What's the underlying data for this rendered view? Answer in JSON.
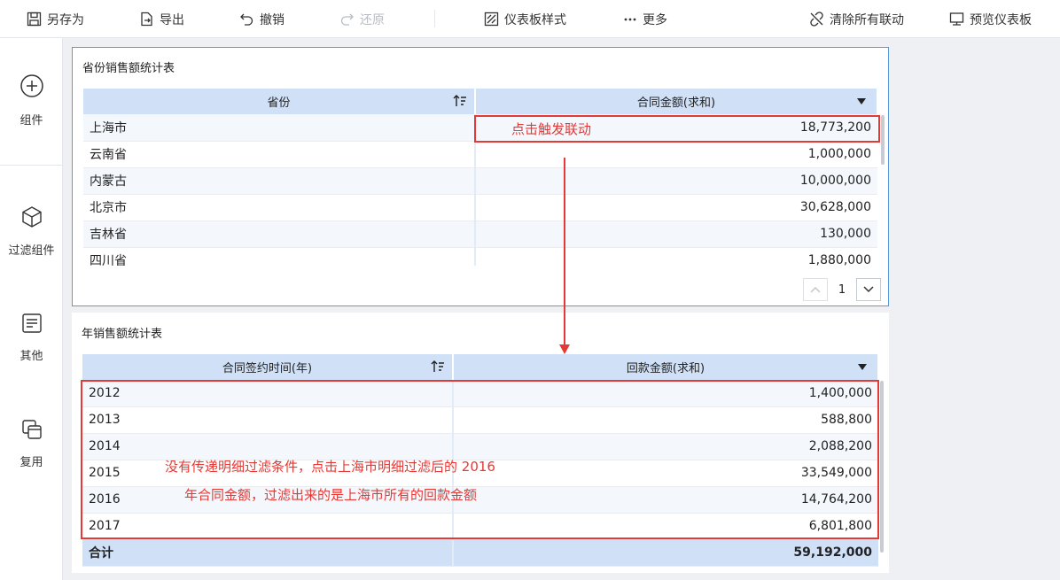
{
  "toolbar": {
    "save_as": "另存为",
    "export": "导出",
    "undo": "撤销",
    "redo": "还原",
    "dashboard_style": "仪表板样式",
    "more": "更多",
    "clear_links": "清除所有联动",
    "preview": "预览仪表板"
  },
  "rail": {
    "components": "组件",
    "filter_components": "过滤组件",
    "others": "其他",
    "reuse": "复用"
  },
  "table1": {
    "title": "省份销售额统计表",
    "col1": "省份",
    "col2": "合同金额(求和)",
    "rows": [
      {
        "province": "上海市",
        "amount": "18,773,200"
      },
      {
        "province": "云南省",
        "amount": "1,000,000"
      },
      {
        "province": "内蒙古",
        "amount": "10,000,000"
      },
      {
        "province": "北京市",
        "amount": "30,628,000"
      },
      {
        "province": "吉林省",
        "amount": "130,000"
      },
      {
        "province": "四川省",
        "amount": "1,880,000"
      }
    ],
    "page": "1"
  },
  "table2": {
    "title": "年销售额统计表",
    "col1": "合同签约时间(年)",
    "col2": "回款金额(求和)",
    "rows": [
      {
        "year": "2012",
        "amount": "1,400,000"
      },
      {
        "year": "2013",
        "amount": "588,800"
      },
      {
        "year": "2014",
        "amount": "2,088,200"
      },
      {
        "year": "2015",
        "amount": "33,549,000"
      },
      {
        "year": "2016",
        "amount": "14,764,200"
      },
      {
        "year": "2017",
        "amount": "6,801,800"
      }
    ],
    "total_label": "合计",
    "total_value": "59,192,000"
  },
  "annotations": {
    "click_hint": "点击触发联动",
    "note_line1": "没有传递明细过滤条件，点击上海市明细过滤后的 2016",
    "note_line2": "年合同金额，过滤出来的是上海市所有的回款金额",
    "color": "#e53935"
  }
}
